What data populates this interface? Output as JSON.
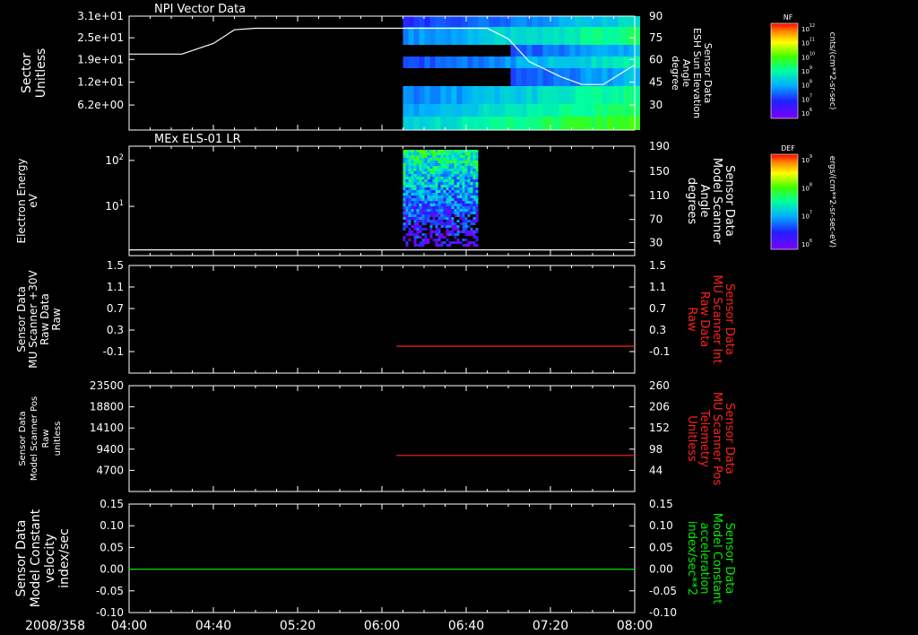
{
  "chart_data": [
    {
      "type": "heatmap",
      "title": "NPI Vector Data",
      "ylabel_lines": [
        "Sector",
        "Unitless"
      ],
      "yticks": [
        "3.1e+01",
        "2.5e+01",
        "1.9e+01",
        "1.2e+01",
        "6.2e+00"
      ],
      "y2label_lines": [
        "Sensor Data",
        "ESH Sun Elevation",
        "Angle",
        "degree"
      ],
      "y2ticks": [
        "90",
        "75",
        "60",
        "45",
        "30"
      ],
      "colorbar_label": "NF",
      "colorbar_ticks": [
        "10^12",
        "10^11",
        "10^10",
        "10^9",
        "10^8",
        "10^7",
        "10^6"
      ],
      "colorbar_units": "cnts/(cm**2-sr-sec)",
      "data_start": "06:10",
      "overlay_line": {
        "series": "ESH Sun Elevation Angle",
        "color": "#ffffff",
        "x": [
          "04:00",
          "04:25",
          "04:40",
          "04:50",
          "05:00",
          "05:30",
          "06:00",
          "06:30",
          "06:50",
          "07:00",
          "07:10",
          "07:25",
          "07:35",
          "07:45",
          "08:00"
        ],
        "y": [
          65,
          65,
          72,
          81,
          82,
          82,
          82,
          82,
          82,
          75,
          60,
          50,
          45,
          45,
          58
        ]
      }
    },
    {
      "type": "heatmap",
      "title": "MEx ELS-01 LR",
      "ylabel_lines": [
        "Electron Energy",
        "eV"
      ],
      "yticks": [
        "10^2",
        "10^1"
      ],
      "y2label_lines": [
        "Sensor Data",
        "Model Scanner",
        "Angle",
        "degrees"
      ],
      "y2ticks": [
        "190",
        "150",
        "110",
        "70",
        "30"
      ],
      "colorbar_label": "DEF",
      "colorbar_ticks": [
        "10^9",
        "10^8",
        "10^7",
        "10^6"
      ],
      "colorbar_units": "ergs/(cm**2-sr-sec-eV)",
      "data_range": [
        "06:10",
        "06:45"
      ],
      "overlay_line": {
        "series": "Model Scanner Angle",
        "color": "#ffffff",
        "x": [
          "04:00",
          "08:00"
        ],
        "y": [
          10,
          10
        ]
      }
    },
    {
      "type": "line",
      "ylabel_lines": [
        "Sensor Data",
        "MU Scanner +30V",
        "Raw Data",
        "Raw"
      ],
      "yticks": [
        "1.5",
        "1.1",
        "0.7",
        "0.3",
        "-0.1"
      ],
      "y2label_lines": [
        "Sensor Data",
        "MU Scanner Int",
        "Raw Data",
        "Raw"
      ],
      "y2label_color": "#ff2020",
      "y2ticks": [
        "1.5",
        "1.1",
        "0.7",
        "0.3",
        "-0.1"
      ],
      "series": [
        {
          "color": "#ff2020",
          "x": [
            "06:07",
            "08:00"
          ],
          "y": [
            0.0,
            0.0
          ]
        }
      ]
    },
    {
      "type": "line",
      "ylabel_lines": [
        "Sensor Data",
        "Model Scanner Pos",
        "Raw",
        "unitless"
      ],
      "yticks": [
        "23500",
        "18800",
        "14100",
        "9400",
        "4700"
      ],
      "y2label_lines": [
        "Sensor Data",
        "MU Scanner Pos",
        "Telemetry",
        "Unitless"
      ],
      "y2label_color": "#ff2020",
      "y2ticks": [
        "260",
        "206",
        "152",
        "98",
        "44"
      ],
      "series": [
        {
          "color": "#ff2020",
          "x": [
            "06:07",
            "08:00"
          ],
          "y": [
            8000,
            8000
          ]
        }
      ]
    },
    {
      "type": "line",
      "ylabel_lines": [
        "Sensor Data",
        "Model Constant",
        "velocity",
        "index/sec"
      ],
      "yticks": [
        "0.15",
        "0.10",
        "0.05",
        "0.00",
        "-0.05",
        "-0.10"
      ],
      "y2label_lines": [
        "Sensor Data",
        "Model Constant",
        "acceleration",
        "index/sec**2"
      ],
      "y2label_color": "#00ee00",
      "y2ticks": [
        "0.15",
        "0.10",
        "0.05",
        "0.00",
        "-0.05",
        "-0.10"
      ],
      "series": [
        {
          "color": "#00dd00",
          "x": [
            "04:00",
            "08:00"
          ],
          "y": [
            0.0,
            0.0
          ]
        }
      ]
    }
  ],
  "x_axis": {
    "date_label": "2008/358",
    "ticks": [
      "04:00",
      "04:40",
      "05:20",
      "06:00",
      "06:40",
      "07:20",
      "08:00"
    ]
  }
}
